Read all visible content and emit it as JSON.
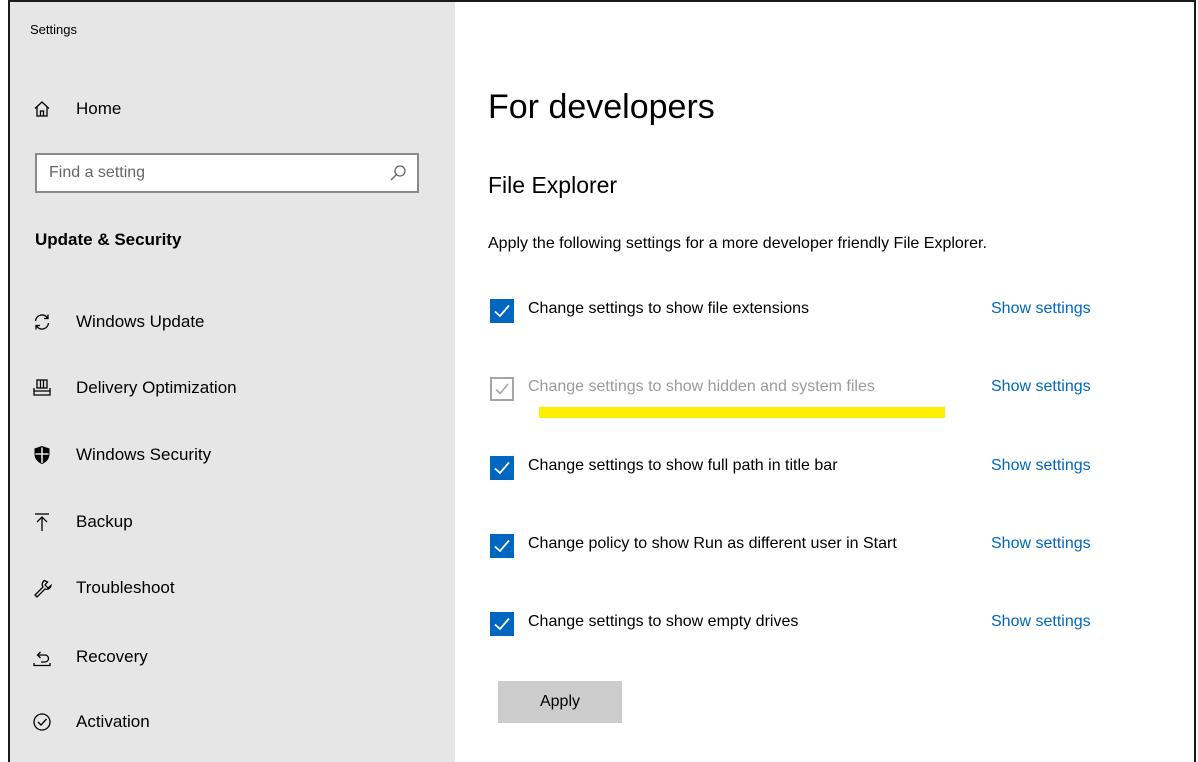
{
  "window": {
    "title": "Settings"
  },
  "sidebar": {
    "home": {
      "label": "Home",
      "icon": "home-icon"
    },
    "search": {
      "placeholder": "Find a setting",
      "value": ""
    },
    "section_title": "Update & Security",
    "items": [
      {
        "label": "Windows Update",
        "icon": "sync-icon"
      },
      {
        "label": "Delivery Optimization",
        "icon": "delivery-optimization-icon"
      },
      {
        "label": "Windows Security",
        "icon": "shield-icon"
      },
      {
        "label": "Backup",
        "icon": "upload-icon"
      },
      {
        "label": "Troubleshoot",
        "icon": "wrench-icon"
      },
      {
        "label": "Recovery",
        "icon": "recovery-icon"
      },
      {
        "label": "Activation",
        "icon": "check-circle-icon"
      }
    ]
  },
  "main": {
    "title": "For developers",
    "subheading": "File Explorer",
    "description": "Apply the following settings for a more developer friendly File Explorer.",
    "options": [
      {
        "label": "Change settings to show file extensions",
        "checked": true,
        "enabled": true,
        "link": "Show settings"
      },
      {
        "label": "Change settings to show hidden and system files",
        "checked": true,
        "enabled": false,
        "link": "Show settings"
      },
      {
        "label": "Change settings to show full path in title bar",
        "checked": true,
        "enabled": true,
        "link": "Show settings"
      },
      {
        "label": "Change policy to show Run as different user in Start",
        "checked": true,
        "enabled": true,
        "link": "Show settings"
      },
      {
        "label": "Change settings to show empty drives",
        "checked": true,
        "enabled": true,
        "link": "Show settings"
      }
    ],
    "apply_label": "Apply"
  },
  "colors": {
    "accent": "#0067c0",
    "sidebar_bg": "#e6e6e6",
    "highlight": "#ffee00",
    "button_bg": "#cccccc",
    "disabled_text": "#9b9b9b"
  }
}
